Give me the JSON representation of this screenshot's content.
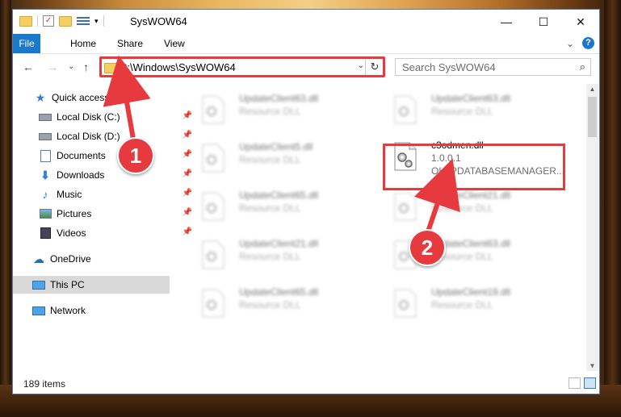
{
  "window": {
    "title": "SysWOW64"
  },
  "controls": {
    "minimize": "—",
    "maximize": "☐",
    "close": "✕"
  },
  "ribbon": {
    "tabs": [
      "File",
      "Home",
      "Share",
      "View"
    ],
    "expand": "⌄",
    "help": "?"
  },
  "nav": {
    "back": "←",
    "forward": "→",
    "recent": "⌄",
    "up": "↑"
  },
  "address": {
    "path": "C:\\Windows\\SysWOW64",
    "dropdown": "⌄",
    "refresh": "↻"
  },
  "search": {
    "placeholder": "Search SysWOW64",
    "icon": "⌕"
  },
  "sidebar": {
    "items": [
      {
        "label": "Quick access",
        "icon": "star-icon",
        "pinned": false
      },
      {
        "label": "Local Disk (C:)",
        "icon": "drive-icon",
        "pinned": true
      },
      {
        "label": "Local Disk (D:)",
        "icon": "drive-icon",
        "pinned": true
      },
      {
        "label": "Documents",
        "icon": "documents-icon",
        "pinned": true
      },
      {
        "label": "Downloads",
        "icon": "download-icon",
        "pinned": true
      },
      {
        "label": "Music",
        "icon": "music-icon",
        "pinned": true
      },
      {
        "label": "Pictures",
        "icon": "pictures-icon",
        "pinned": true
      },
      {
        "label": "Videos",
        "icon": "videos-icon",
        "pinned": true
      },
      {
        "label": "OneDrive",
        "icon": "cloud-icon",
        "pinned": false
      },
      {
        "label": "This PC",
        "icon": "computer-icon",
        "pinned": false,
        "selected": true
      },
      {
        "label": "Network",
        "icon": "network-icon",
        "pinned": false
      }
    ],
    "pin_glyph": "📌"
  },
  "files": [
    {
      "name": "UpdateClient63.dll",
      "type": "Resource DLL",
      "blurred": true
    },
    {
      "name": "UpdateClient63.dll",
      "type": "Resource DLL",
      "blurred": true
    },
    {
      "name": "UpdateClient5.dll",
      "type": "Resource DLL",
      "blurred": true
    },
    {
      "name": "c3odmen.dll",
      "version": "1.0.0.1",
      "description": "OLAPDATABASEMANAGER...",
      "blurred": false
    },
    {
      "name": "UpdateClient65.dll",
      "type": "Resource DLL",
      "blurred": true
    },
    {
      "name": "UpdateClient21.dll",
      "type": "Resource DLL",
      "blurred": true
    },
    {
      "name": "UpdateClient21.dll",
      "type": "Resource DLL",
      "blurred": true
    },
    {
      "name": "UpdateClient63.dll",
      "type": "Resource DLL",
      "blurred": true
    },
    {
      "name": "UpdateClient65.dll",
      "type": "Resource DLL",
      "blurred": true
    },
    {
      "name": "UpdateClient19.dll",
      "type": "Resource DLL",
      "blurred": true
    }
  ],
  "status": {
    "count": "189 items"
  },
  "annotations": {
    "step1": "1",
    "step2": "2",
    "color": "#e63a3e"
  }
}
